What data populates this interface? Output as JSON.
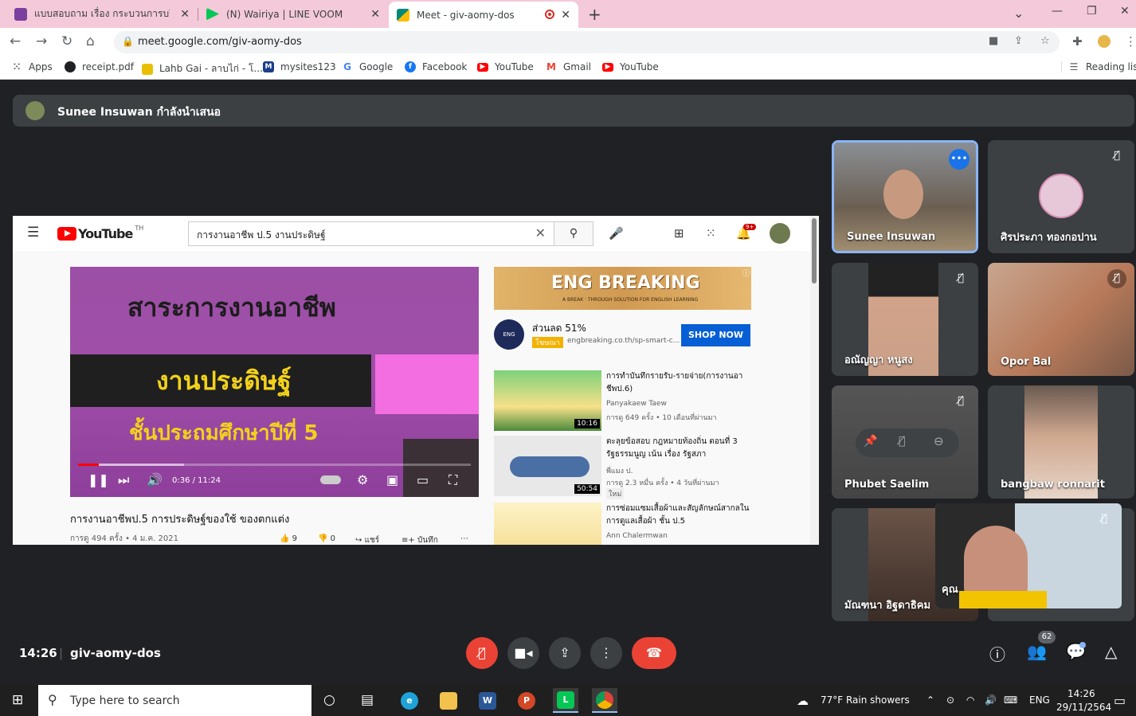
{
  "browser": {
    "tabs": [
      {
        "title": "แบบสอบถาม เรื่อง กระบวนการบริหารจั",
        "color": "#7b3fa0"
      },
      {
        "title": "(N) Wairiya | LINE VOOM",
        "color": "#06c755"
      },
      {
        "title": "Meet - giv-aomy-dos",
        "color": "#00897b"
      }
    ],
    "url": "meet.google.com/giv-aomy-dos",
    "bookmarks": [
      {
        "label": "Apps",
        "icon": "apps-grid-icon",
        "color": "#5f6368"
      },
      {
        "label": "receipt.pdf",
        "icon": "globe-icon",
        "color": "#202124"
      },
      {
        "label": "Lahb Gai - ลาบไก่ - โ...",
        "icon": "lahb-gai-icon",
        "color": "#e8c000"
      },
      {
        "label": "mysites123",
        "icon": "m-icon",
        "color": "#1a3e8c"
      },
      {
        "label": "Google",
        "icon": "google-icon",
        "color": "#4285f4"
      },
      {
        "label": "Facebook",
        "icon": "facebook-icon",
        "color": "#1877f2"
      },
      {
        "label": "YouTube",
        "icon": "youtube-icon",
        "color": "#ff0000"
      },
      {
        "label": "Gmail",
        "icon": "gmail-icon",
        "color": "#ea4335"
      },
      {
        "label": "YouTube",
        "icon": "youtube-icon",
        "color": "#ff0000"
      }
    ],
    "reading_list": "Reading list"
  },
  "meet": {
    "presenter_banner": "Sunee Insuwan กำลังนำเสนอ",
    "time": "14:26",
    "separator": "|",
    "meeting_code": "giv-aomy-dos",
    "participant_count": "62",
    "participants": [
      {
        "name": "Sunee Insuwan",
        "muted": false
      },
      {
        "name": "ศิรประภา ทองกอปาน",
        "muted": true
      },
      {
        "name": "อณัญญา หนูสง",
        "muted": true
      },
      {
        "name": "Opor Bal",
        "muted": true
      },
      {
        "name": "Phubet Saelim",
        "muted": true
      },
      {
        "name": "bangbaw ronnarit",
        "muted": false
      },
      {
        "name": "มัณฑนา อิฐดาธิคม",
        "muted": false
      }
    ],
    "self_name": "คุณ"
  },
  "youtube": {
    "logo_word": "YouTube",
    "logo_region": "TH",
    "search_query": "การงานอาชีพ ป.5 งานประดิษฐ์",
    "notification_count": "9+",
    "player": {
      "line1": "สาระการงานอาชีพ",
      "line2": "งานประดิษฐ์",
      "line3": "ชั้นประถมศึกษาปีที่ 5",
      "time": "0:36 / 11:24",
      "progress": 0.053,
      "buffered": 0.27
    },
    "video_title": "การงานอาชีพป.5 การประดิษฐ์ของใช้ ของตกแต่ง",
    "video_meta": "การดู 494 ครั้ง • 4 ม.ค. 2021",
    "likes": "9",
    "dislikes": "0",
    "share_label": "แชร์",
    "save_label": "บันทึก",
    "ad": {
      "banner_title": "ENG BREAKING",
      "banner_sub": "A BREAK · THROUGH SOLUTION FOR ENGLISH LEARNING",
      "logo_text": "ENG",
      "discount": "ส่วนลด 51%",
      "label": "โฆษณา",
      "url": "engbreaking.co.th/sp-smart-c...",
      "cta": "SHOP NOW"
    },
    "recommendations": [
      {
        "title": "การทำบันทึกรายรับ-รายจ่าย(การงานอาชีพป.6)",
        "channel": "Panyakaew Taew",
        "meta": "การดู 649 ครั้ง • 10 เดือนที่ผ่านมา",
        "duration": "10:16"
      },
      {
        "title": "ตะลุยข้อสอบ กฎหมายท้องถิ่น ตอนที่ 3 รัฐธรรมนูญ เน้น เรื่อง รัฐสภา",
        "channel": "พี่แมง ป.",
        "meta": "การดู 2.3 หมื่น ครั้ง • 4 วันที่ผ่านมา",
        "badge": "ใหม่",
        "duration": "50:54"
      },
      {
        "title": "การซ่อมแซมเสื้อผ้าและสัญลักษณ์สากลในการดูแลเสื้อผ้า ชั้น ป.5",
        "channel": "Ann Chalermwan"
      }
    ]
  },
  "taskbar": {
    "search_placeholder": "Type here to search",
    "weather": "77°F  Rain showers",
    "lang": "ENG",
    "time": "14:26",
    "date": "29/11/2564"
  }
}
